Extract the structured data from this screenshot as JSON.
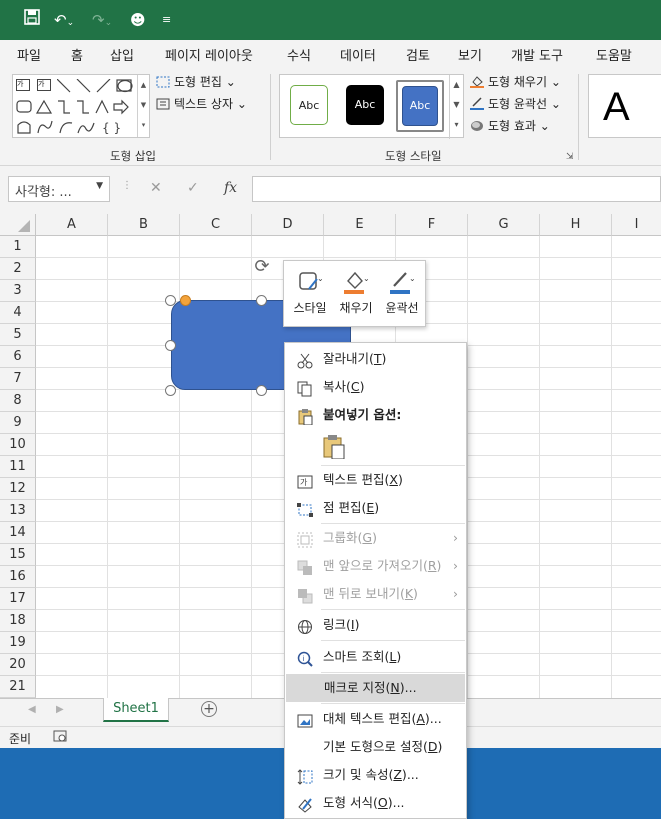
{
  "quick_access": {
    "save_icon": "save-icon",
    "undo_icon": "undo-icon",
    "redo_icon": "redo-icon",
    "smiley_icon": "smiley-icon",
    "customize_icon": "customize-icon"
  },
  "tabs": [
    "파일",
    "홈",
    "삽입",
    "페이지 레이아웃",
    "수식",
    "데이터",
    "검토",
    "보기",
    "개발 도구",
    "도움말"
  ],
  "ribbon": {
    "insert_shapes": {
      "edit_shape": "도형 편집",
      "text_box": "텍스트 상자",
      "group_label": "도형 삽입"
    },
    "shape_styles": {
      "abc": "Abc",
      "fill": "도형 채우기",
      "outline": "도형 윤곽선",
      "effects": "도형 효과",
      "group_label": "도형 스타일"
    },
    "wordart_letter": "A"
  },
  "formula_bar": {
    "name_box": "사각형: ...",
    "fx": "fx"
  },
  "columns": [
    "A",
    "B",
    "C",
    "D",
    "E",
    "F",
    "G",
    "H",
    "I"
  ],
  "rows": [
    "1",
    "2",
    "3",
    "4",
    "5",
    "6",
    "7",
    "8",
    "9",
    "10",
    "11",
    "12",
    "13",
    "14",
    "15",
    "16",
    "17",
    "18",
    "19",
    "20",
    "21"
  ],
  "mini_toolbar": {
    "style": "스타일",
    "fill": "채우기",
    "outline": "윤곽선"
  },
  "context_menu": {
    "cut": "잘라내기",
    "cut_key": "T",
    "copy": "복사",
    "copy_key": "C",
    "paste_options": "붙여넣기 옵션:",
    "edit_text": "텍스트 편집",
    "edit_text_key": "X",
    "edit_points": "점 편집",
    "edit_points_key": "E",
    "group": "그룹화",
    "group_key": "G",
    "bring_front": "맨 앞으로 가져오기",
    "bring_front_key": "R",
    "send_back": "맨 뒤로 보내기",
    "send_back_key": "K",
    "link": "링크",
    "link_key": "I",
    "smart_lookup": "스마트 조회",
    "smart_lookup_key": "L",
    "assign_macro": "매크로 지정",
    "assign_macro_key": "N",
    "alt_text": "대체 텍스트 편집",
    "alt_text_key": "A",
    "set_default": "기본 도형으로 설정",
    "set_default_key": "D",
    "size_props": "크기 및 속성",
    "size_props_key": "Z",
    "format_shape": "도형 서식",
    "format_shape_key": "O",
    "ellipsis": "..."
  },
  "sheet": {
    "tab": "Sheet1"
  },
  "status": {
    "ready": "준비"
  },
  "colors": {
    "excel_green": "#217346",
    "shape_fill": "#4472c4",
    "taskbar": "#1e6cb4"
  }
}
